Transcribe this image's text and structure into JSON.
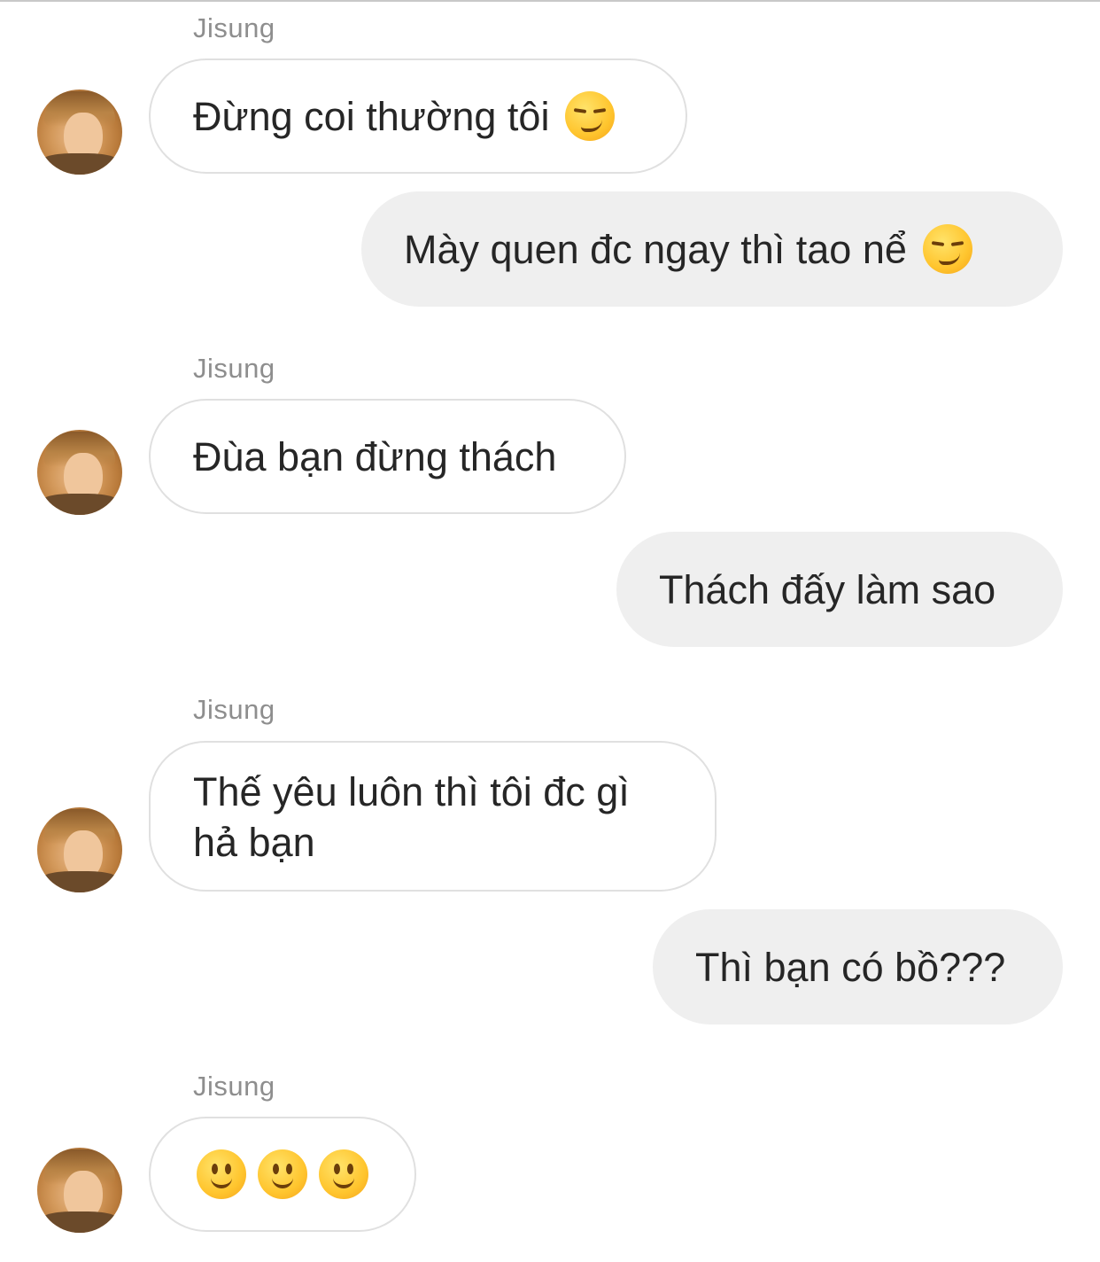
{
  "conversation": {
    "messages": [
      {
        "direction": "incoming",
        "sender": "Jisung",
        "text": "Đừng coi thường tôi",
        "emoji": "smirk-emoji"
      },
      {
        "direction": "outgoing",
        "text": "Mày quen đc ngay thì tao nể",
        "emoji": "smirk-emoji"
      },
      {
        "direction": "incoming",
        "sender": "Jisung",
        "text": "Đùa bạn đừng thách"
      },
      {
        "direction": "outgoing",
        "text": "Thách đấy làm sao"
      },
      {
        "direction": "incoming",
        "sender": "Jisung",
        "line1": "Thế yêu luôn thì tôi đc gì",
        "line2": "hả bạn"
      },
      {
        "direction": "outgoing",
        "text": "Thì bạn có bồ???"
      },
      {
        "direction": "incoming",
        "sender": "Jisung",
        "emojis": [
          "slightly-smiling-face-emoji",
          "slightly-smiling-face-emoji",
          "slightly-smiling-face-emoji"
        ]
      }
    ]
  },
  "colors": {
    "incoming_bubble_border": "#e0e0e0",
    "outgoing_bubble_bg": "#efefef",
    "sender_name": "#8e8e8e",
    "text": "#262626"
  }
}
